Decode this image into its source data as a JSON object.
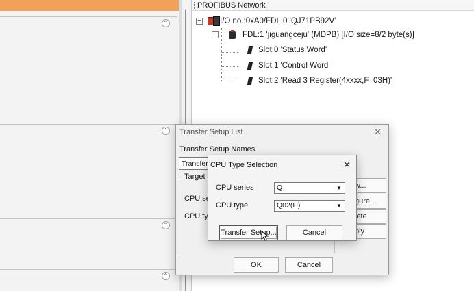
{
  "network": {
    "header": "PROFIBUS Network",
    "tree": [
      {
        "label": "I/O no.:0xA0/FDL:0 'QJ71PB92V'",
        "expander": "−"
      },
      {
        "label": "FDL:1 'jiguangceju' (MDPB) [I/O size=8/2 byte(s)]",
        "expander": "−"
      },
      {
        "label": "Slot:0 'Status Word'"
      },
      {
        "label": "Slot:1 'Control Word'"
      },
      {
        "label": "Slot:2 'Read 3 Register(4xxxx,F=03H)'"
      }
    ]
  },
  "left_panel": {
    "collapse_glyph": "⌃"
  },
  "transfer_setup_list": {
    "title": "Transfer Setup List",
    "close_glyph": "✕",
    "names_label": "Transfer Setup Names",
    "names_value": "TransferS",
    "target_group_label": "Target F",
    "cpu_series_label": "CPU ser",
    "cpu_type_label": "CPU typ",
    "side_buttons": [
      "w...",
      "gure...",
      "lete",
      "ply"
    ],
    "ok": "OK",
    "cancel": "Cancel"
  },
  "cpu_type_selection": {
    "title": "CPU Type Selection",
    "close_glyph": "✕",
    "cpu_series_label": "CPU series",
    "cpu_series_value": "Q",
    "cpu_type_label": "CPU type",
    "cpu_type_value": "Q02(H)",
    "dropdown_glyph": "▼",
    "transfer_setup_button": "Transfer Setup...",
    "cancel_button": "Cancel"
  }
}
